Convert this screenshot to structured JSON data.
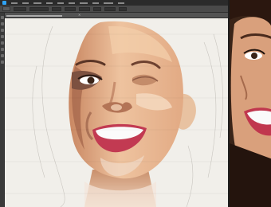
{
  "colors": {
    "menubar_bg": "#2b2b2b",
    "options_bg": "#4a4a4a",
    "canvas_bg": "#f1efea",
    "skin_base": "#e7b791",
    "skin_shadow": "#b97c5e",
    "lip": "#c23a52",
    "accent": "#2fa3f5"
  },
  "icons": {
    "app_logo": "photoshop-logo-icon",
    "tab_close": "close-icon"
  }
}
